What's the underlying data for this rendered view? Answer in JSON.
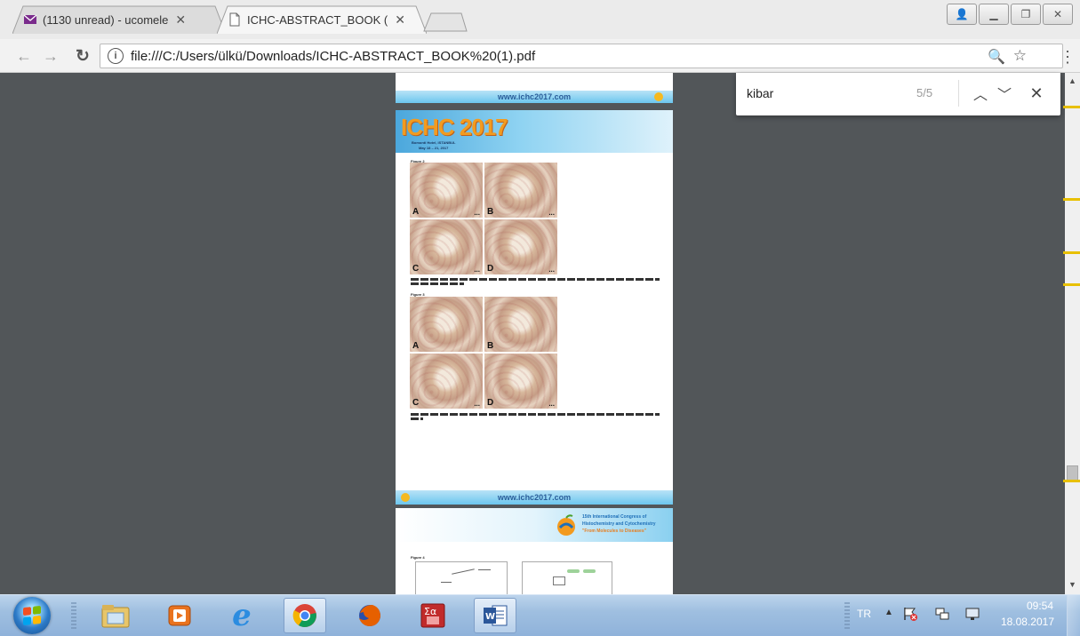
{
  "tabs": [
    {
      "title": "(1130 unread) - ucomele",
      "icon": "mail-icon"
    },
    {
      "title": "ICHC-ABSTRACT_BOOK (",
      "icon": "document-icon"
    }
  ],
  "address_bar": {
    "url": "file:///C:/Users/ülkü/Downloads/ICHC-ABSTRACT_BOOK%20(1).pdf"
  },
  "find_bar": {
    "query": "kibar",
    "match_count": "5/5"
  },
  "pdf": {
    "footer_url": "www.ichc2017.com",
    "header_title": "ICHC 2017",
    "header_venue": "Bomonti Hotel, ISTANBUL",
    "header_dates": "May 18 – 21, 2017",
    "figure2_label": "Figure 2",
    "figure3_label": "Figure 3",
    "figure4_label": "Figure 4",
    "panels": [
      "A",
      "B",
      "C",
      "D"
    ],
    "panel_scale": "...",
    "next_page_line1": "15th International Congress of",
    "next_page_line2": "Histochemistry and Cytochemistry",
    "next_page_line3": "\"From Molecules to Diseases\""
  },
  "taskbar": {
    "language": "TR",
    "time": "09:54",
    "date": "18.08.2017"
  },
  "colors": {
    "viewer_bg": "#525659",
    "find_match": "#e8c000",
    "taskbar": "#9fbfe0"
  }
}
